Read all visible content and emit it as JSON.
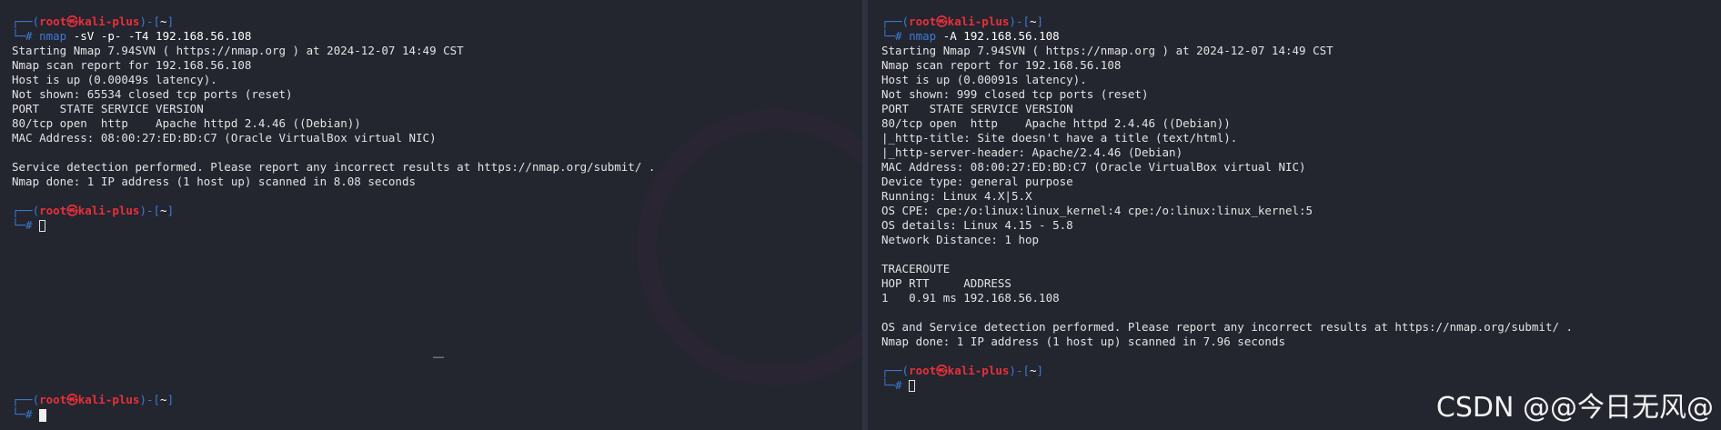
{
  "prompt": {
    "corner_top": "┌──(",
    "user": "root㉿kali-plus",
    "sep": ")-[",
    "dir": "~",
    "close": "]",
    "corner_bottom": "└─#"
  },
  "left": {
    "command1": {
      "name": "nmap",
      "args": "-sV -p- -T4 192.168.56.108"
    },
    "output": [
      "Starting Nmap 7.94SVN ( https://nmap.org ) at 2024-12-07 14:49 CST",
      "Nmap scan report for 192.168.56.108",
      "Host is up (0.00049s latency).",
      "Not shown: 65534 closed tcp ports (reset)",
      "PORT   STATE SERVICE VERSION",
      "80/tcp open  http    Apache httpd 2.4.46 ((Debian))",
      "MAC Address: 08:00:27:ED:BD:C7 (Oracle VirtualBox virtual NIC)",
      "",
      "Service detection performed. Please report any incorrect results at https://nmap.org/submit/ .",
      "Nmap done: 1 IP address (1 host up) scanned in 8.08 seconds"
    ],
    "dots": "……"
  },
  "right": {
    "command1": {
      "name": "nmap",
      "args": "-A 192.168.56.108"
    },
    "output": [
      "Starting Nmap 7.94SVN ( https://nmap.org ) at 2024-12-07 14:49 CST",
      "Nmap scan report for 192.168.56.108",
      "Host is up (0.00091s latency).",
      "Not shown: 999 closed tcp ports (reset)",
      "PORT   STATE SERVICE VERSION",
      "80/tcp open  http    Apache httpd 2.4.46 ((Debian))",
      "|_http-title: Site doesn't have a title (text/html).",
      "|_http-server-header: Apache/2.4.46 (Debian)",
      "MAC Address: 08:00:27:ED:BD:C7 (Oracle VirtualBox virtual NIC)",
      "Device type: general purpose",
      "Running: Linux 4.X|5.X",
      "OS CPE: cpe:/o:linux:linux_kernel:4 cpe:/o:linux:linux_kernel:5",
      "OS details: Linux 4.15 - 5.8",
      "Network Distance: 1 hop",
      "",
      "TRACEROUTE",
      "HOP RTT     ADDRESS",
      "1   0.91 ms 192.168.56.108",
      "",
      "OS and Service detection performed. Please report any incorrect results at https://nmap.org/submit/ .",
      "Nmap done: 1 IP address (1 host up) scanned in 7.96 seconds"
    ]
  },
  "watermark": "CSDN @@今日无风@"
}
